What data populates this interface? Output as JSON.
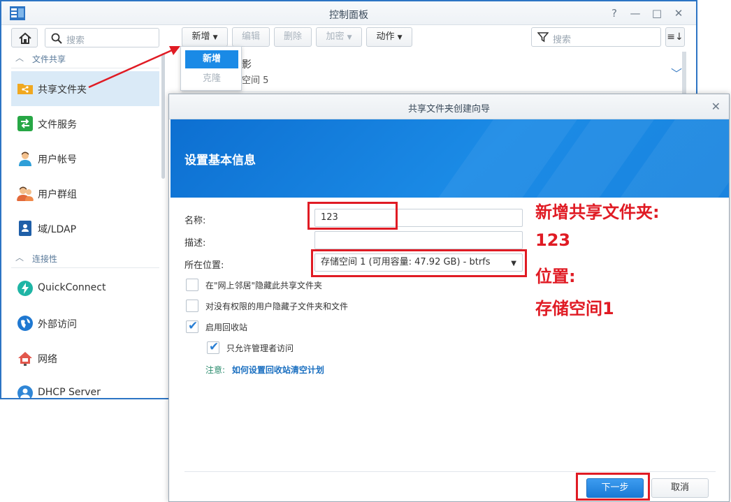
{
  "control_panel": {
    "title": "控制面板",
    "window_buttons": [
      "?",
      "—",
      "□",
      "✕"
    ]
  },
  "sidebar": {
    "search_placeholder": "搜索",
    "sections": [
      {
        "label": "文件共享"
      },
      {
        "label": "连接性"
      }
    ],
    "items": [
      {
        "label": "共享文件夹",
        "icon": "shared-folder-icon",
        "active": true
      },
      {
        "label": "文件服务",
        "icon": "file-services-icon"
      },
      {
        "label": "用户帐号",
        "icon": "user-icon"
      },
      {
        "label": "用户群组",
        "icon": "user-group-icon"
      },
      {
        "label": "域/LDAP",
        "icon": "domain-ldap-icon"
      },
      {
        "label": "QuickConnect",
        "icon": "quickconnect-icon"
      },
      {
        "label": "外部访问",
        "icon": "external-access-icon"
      },
      {
        "label": "网络",
        "icon": "network-icon"
      },
      {
        "label": "DHCP Server",
        "icon": "dhcp-server-icon"
      }
    ]
  },
  "toolbar": {
    "new_label": "新增",
    "edit_label": "编辑",
    "delete_label": "删除",
    "encrypt_label": "加密",
    "action_label": "动作",
    "search_placeholder": "搜索"
  },
  "dropdown": {
    "new_label": "新增",
    "clone_label": "克隆"
  },
  "list_row": {
    "title": "影",
    "subtitle": "空间 5"
  },
  "wizard": {
    "title": "共享文件夹创建向导",
    "heading": "设置基本信息",
    "name_label": "名称:",
    "name_value": "123",
    "desc_label": "描述:",
    "desc_value": "",
    "location_label": "所在位置:",
    "location_value": "存储空间 1 (可用容量:  47.92 GB) - btrfs",
    "checkboxes": [
      {
        "label": "在\"网上邻居\"隐藏此共享文件夹",
        "checked": false
      },
      {
        "label": "对没有权限的用户隐藏子文件夹和文件",
        "checked": false
      },
      {
        "label": "启用回收站",
        "checked": true
      },
      {
        "label": "只允许管理者访问",
        "checked": true
      }
    ],
    "note_label": "注意:",
    "note_link": "如何设置回收站清空计划",
    "next_label": "下一步",
    "cancel_label": "取消"
  },
  "annotations": {
    "line1": "新增共享文件夹:",
    "line2": "123",
    "line3": "位置:",
    "line4": "存储空间1"
  },
  "colors": {
    "accent": "#1a8ae6",
    "annotation_red": "#e01b24",
    "active_sidebar": "#daeaf7"
  }
}
